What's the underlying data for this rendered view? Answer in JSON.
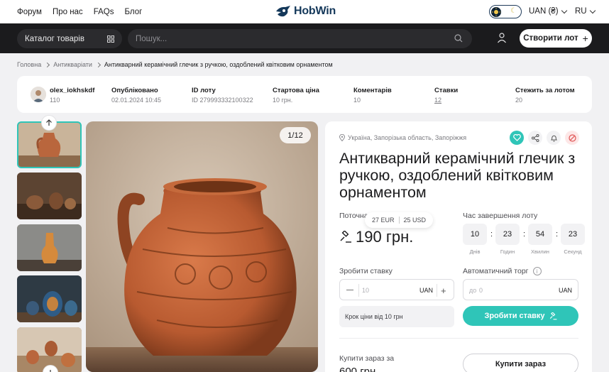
{
  "nav": {
    "links": [
      "Форум",
      "Про нас",
      "FAQs",
      "Блог"
    ],
    "logo": "HobWin",
    "currency": "UAN (₴)",
    "language": "RU"
  },
  "toolbar": {
    "catalog": "Каталог товарів",
    "search_placeholder": "Пошук...",
    "create_lot": "Створити лот"
  },
  "breadcrumb": [
    "Головна",
    "Антикваріати",
    "Антикварний керамічний глечик з ручкою, оздоблений квітковим орнаментом"
  ],
  "info": [
    {
      "label": "olex_iokhskdf",
      "value": "110"
    },
    {
      "label": "Опубліковано",
      "value": "02.01.2024 10:45"
    },
    {
      "label": "ID лоту",
      "value": "ID 279993332100322"
    },
    {
      "label": "Стартова ціна",
      "value": "10 грн."
    },
    {
      "label": "Коментарів",
      "value": "10"
    },
    {
      "label": "Ставки",
      "value": "12"
    },
    {
      "label": "Стежить за лотом",
      "value": "20"
    }
  ],
  "gallery": {
    "counter": "1/12"
  },
  "lot": {
    "location": "Україна, Запорізька область, Запоріжжя",
    "title": "Антикварний керамічний глечик з ручкою, оздоблений квітковим орнаментом",
    "current_label": "Поточна",
    "conv_eur": "27 EUR",
    "conv_usd": "25 USD",
    "price": "190 грн.",
    "end_label": "Час завершення лоту",
    "timer": [
      {
        "value": "10",
        "label": "Днів"
      },
      {
        "value": "23",
        "label": "Годин"
      },
      {
        "value": "54",
        "label": "Хвилин"
      },
      {
        "value": "23",
        "label": "Секунд"
      }
    ],
    "bid_label": "Зробити ставку",
    "bid_placeholder": "10",
    "currency": "UAN",
    "auto_label": "Автоматичний торг",
    "auto_from": "до",
    "auto_placeholder": "0",
    "step": "Крок ціни від 10 грн",
    "bid_button": "Зробити ставку",
    "buynow_label": "Купити зараз за",
    "buynow_price": "600 грн.",
    "buynow_button": "Купити зараз"
  },
  "colors": {
    "accent": "#2fc5b8",
    "dark": "#1b1b1d",
    "brand": "#14385a"
  }
}
